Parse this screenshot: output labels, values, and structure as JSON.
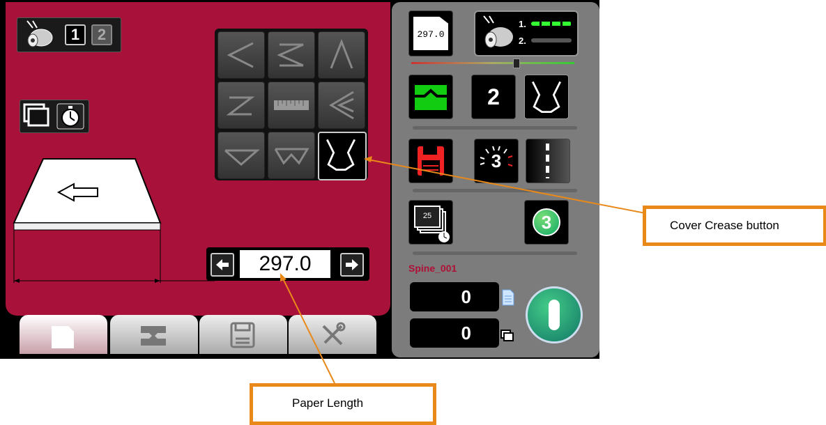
{
  "colors": {
    "panel": "#a8123a",
    "side": "#7c7c7c",
    "accent": "#e8891a",
    "green": "#22cc33"
  },
  "left": {
    "feeder_keys": [
      "1",
      "2"
    ],
    "length_value": "297.0"
  },
  "right": {
    "doc_length": "297.0",
    "feeder_labels": [
      "1.",
      "2."
    ],
    "station_count": "2",
    "count_badge": "3",
    "stack_count": "25",
    "round_badge": "3",
    "job_name": "Spine_001",
    "counter_sheets": "0",
    "counter_sets": "0"
  },
  "annotations": {
    "cover_crease": "Cover Crease button",
    "paper_length": "Paper Length"
  },
  "icons": [
    "feeder-roller-icon",
    "stack-icon",
    "timer-icon",
    "arrow-left-icon",
    "arrow-right-icon",
    "crease-pattern-icon",
    "ruler-icon",
    "cover-crease-icon",
    "save-icon",
    "power-icon",
    "tools-icon"
  ]
}
